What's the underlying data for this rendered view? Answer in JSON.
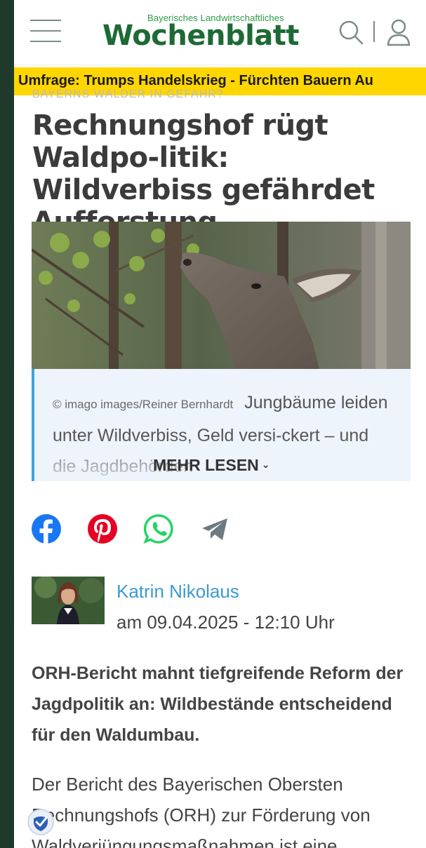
{
  "header": {
    "logo_tagline": "Bayerisches Landwirtschaftliches",
    "logo_name": "Wochenblatt",
    "menu_icon": "hamburger-menu-icon",
    "search_icon": "search-icon",
    "user_icon": "user-icon"
  },
  "ticker": {
    "text": "Umfrage: Trumps Handelskrieg - Fürchten Bauern Au"
  },
  "article": {
    "kicker": "BAYERNS WÄLDER IN GEFAHR?",
    "title": "Rechnungshof rügt Waldpo-litik: Wildverbiss gefährdet Aufforstung",
    "image_alt": "Hirsch frisst an jungen Baumtrieben",
    "caption_credit": "© imago images/Reiner Bernhardt",
    "caption_text": "Jungbäume leiden unter Wildverbiss, Geld versi-ckert – und die Jagdbehörden",
    "read_more": "MEHR LESEN",
    "lead": "ORH-Bericht mahnt tiefgreifende Reform der Jagdpolitik an: Wildbestände entscheidend für den Waldumbau.",
    "body": "Der Bericht des Bayerischen Obersten Rechnungshofs (ORH) zur Förderung von Waldverjüngungsmaßnahmen ist eine"
  },
  "share": {
    "facebook": "facebook-icon",
    "pinterest": "pinterest-icon",
    "whatsapp": "whatsapp-icon",
    "telegram": "telegram-icon"
  },
  "author": {
    "name": "Katrin Nikolaus",
    "date": "am 09.04.2025 - 12:10 Uhr"
  },
  "colors": {
    "brand_green": "#1d6a34",
    "ticker_yellow": "#ffd600",
    "link_blue": "#3a9ad4",
    "facebook": "#1877f2",
    "pinterest": "#e60023",
    "whatsapp": "#25d366"
  }
}
